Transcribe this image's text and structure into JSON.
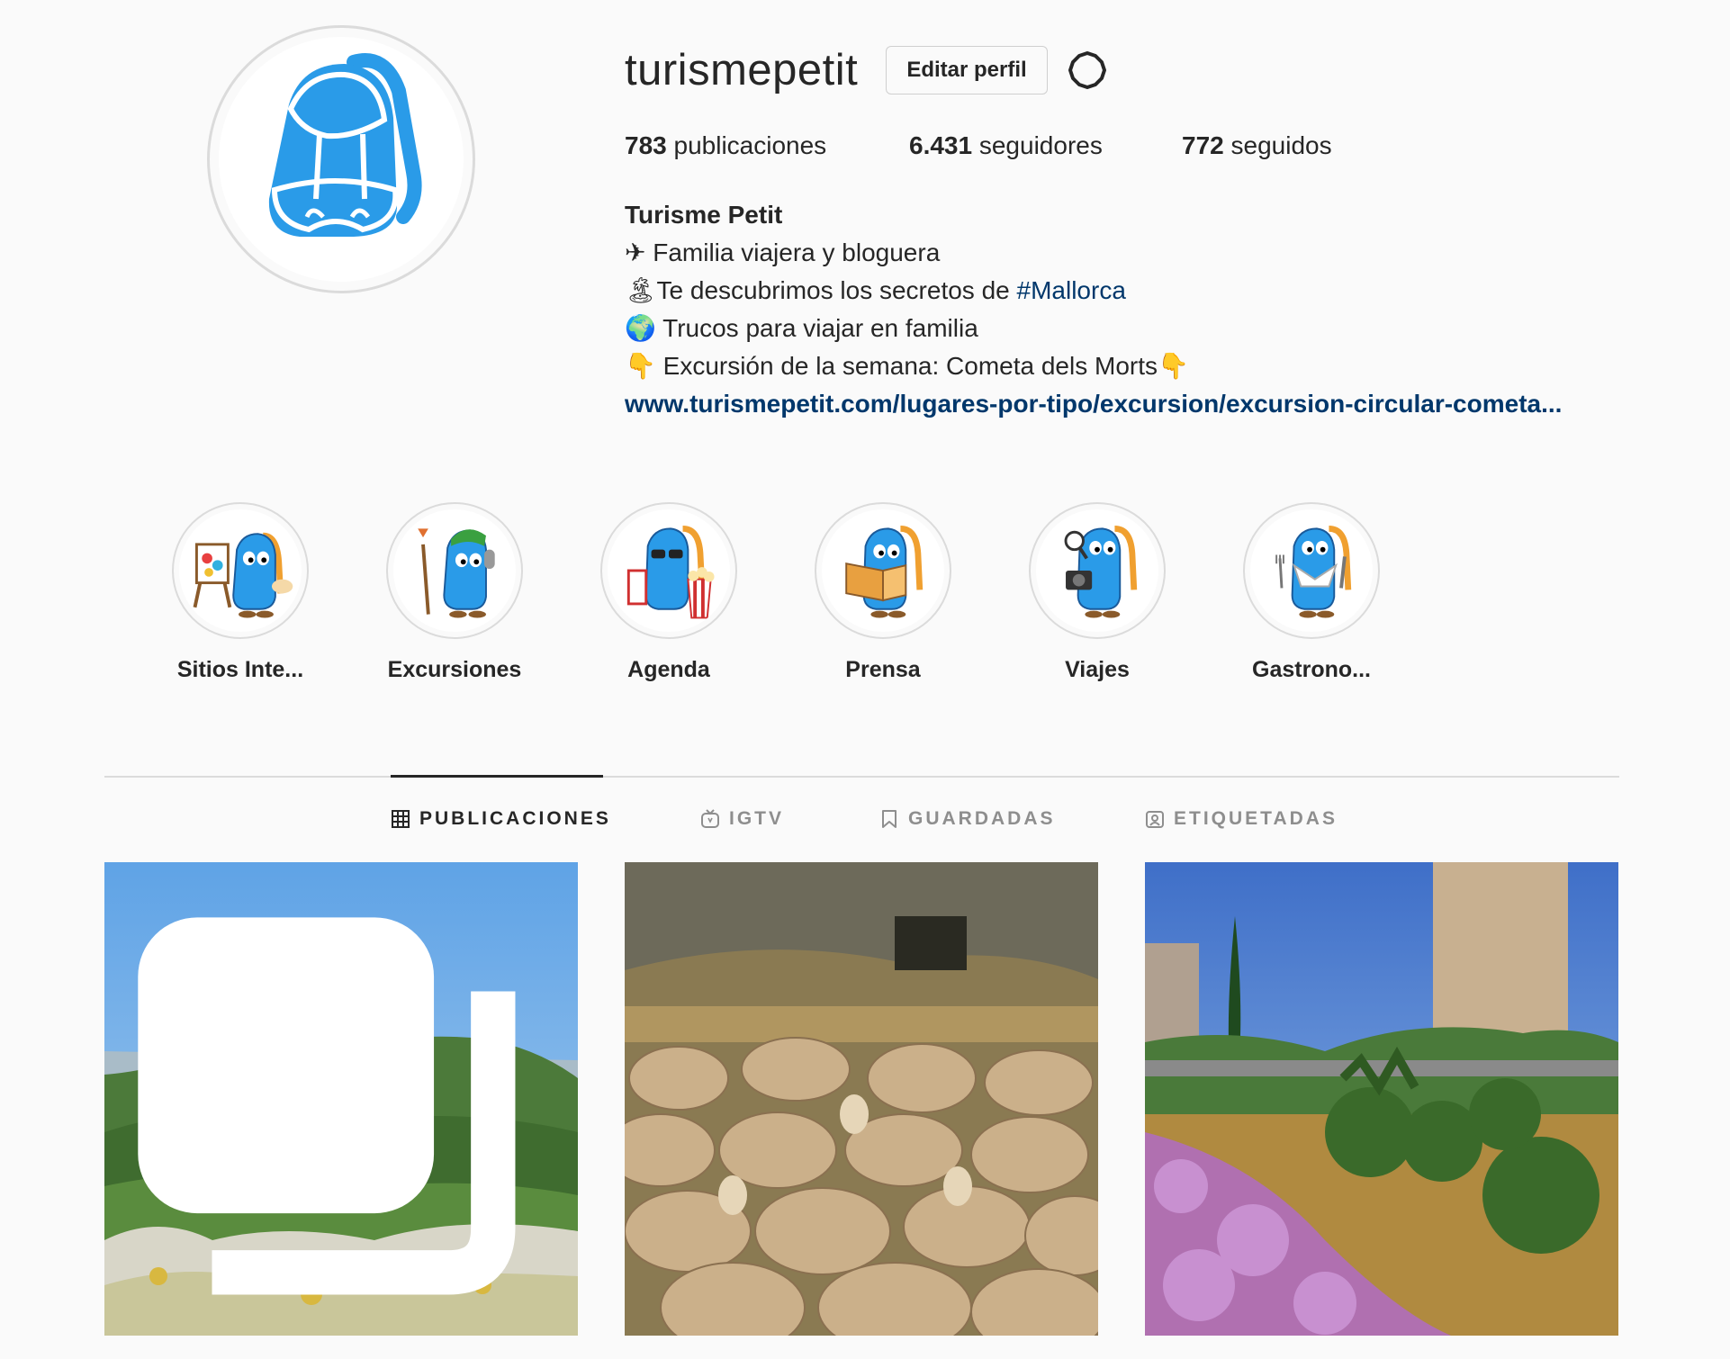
{
  "profile": {
    "username": "turismepetit",
    "edit_button": "Editar perfil",
    "stats": {
      "posts_count": "783",
      "posts_label": "publicaciones",
      "followers_count": "6.431",
      "followers_label": "seguidores",
      "following_count": "772",
      "following_label": "seguidos"
    },
    "bio": {
      "full_name": "Turisme Petit",
      "line1": "✈ Familia viajera y bloguera",
      "line2_prefix": "🏝Te descubrimos los secretos de ",
      "line2_hashtag": "#Mallorca",
      "line3": "🌍 Trucos para viajar en familia",
      "line4": "👇 Excursión de la semana: Cometa dels Morts👇",
      "link": "www.turismepetit.com/lugares-por-tipo/excursion/excursion-circular-cometa..."
    }
  },
  "highlights": [
    {
      "label": "Sitios Inte..."
    },
    {
      "label": "Excursiones"
    },
    {
      "label": "Agenda"
    },
    {
      "label": "Prensa"
    },
    {
      "label": "Viajes"
    },
    {
      "label": "Gastrono..."
    }
  ],
  "tabs": [
    {
      "label": "PUBLICACIONES",
      "icon": "grid-icon",
      "active": true
    },
    {
      "label": "IGTV",
      "icon": "igtv-icon",
      "active": false
    },
    {
      "label": "GUARDADAS",
      "icon": "bookmark-icon",
      "active": false
    },
    {
      "label": "ETIQUETADAS",
      "icon": "tagged-icon",
      "active": false
    }
  ],
  "colors": {
    "background": "#fafafa",
    "text": "#262626",
    "secondary_text": "#8e8e8e",
    "link": "#00376b",
    "border": "#dbdbdb",
    "mascot_blue": "#2a9be8",
    "mascot_orange": "#f0a030"
  }
}
